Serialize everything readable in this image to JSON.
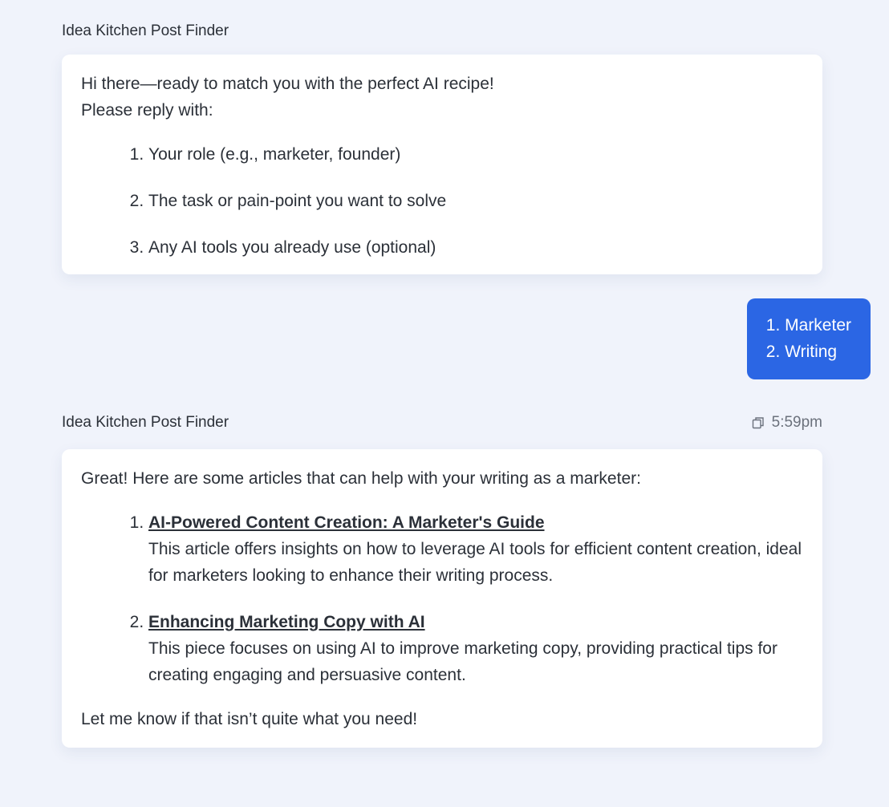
{
  "messages": {
    "first": {
      "sender": "Idea Kitchen Post Finder",
      "greeting": "Hi there—ready to match you with the perfect AI recipe!",
      "prompt": "Please reply with:",
      "items": [
        "Your role (e.g., marketer, founder)",
        "The task or pain-point you want to solve",
        "Any AI tools you already use (optional)"
      ]
    },
    "user": {
      "lines": [
        "1. Marketer",
        "2. Writing"
      ]
    },
    "second": {
      "sender": "Idea Kitchen Post Finder",
      "time": "5:59pm",
      "copy_icon": "copy-icon",
      "intro": "Great! Here are some articles that can help with your writing as a marketer:",
      "articles": [
        {
          "title": "AI-Powered Content Creation: A Marketer's Guide",
          "description": "This article offers insights on how to leverage AI tools for efficient content creation, ideal for marketers looking to enhance their writing process."
        },
        {
          "title": "Enhancing Marketing Copy with AI",
          "description": "This piece focuses on using AI to improve marketing copy, providing practical tips for creating engaging and persuasive content."
        }
      ],
      "outro": "Let me know if that isn’t quite what you need!"
    }
  },
  "colors": {
    "background": "#f0f3fb",
    "user_bubble": "#2b66e4",
    "text": "#2b3038",
    "muted": "#6b717c"
  }
}
